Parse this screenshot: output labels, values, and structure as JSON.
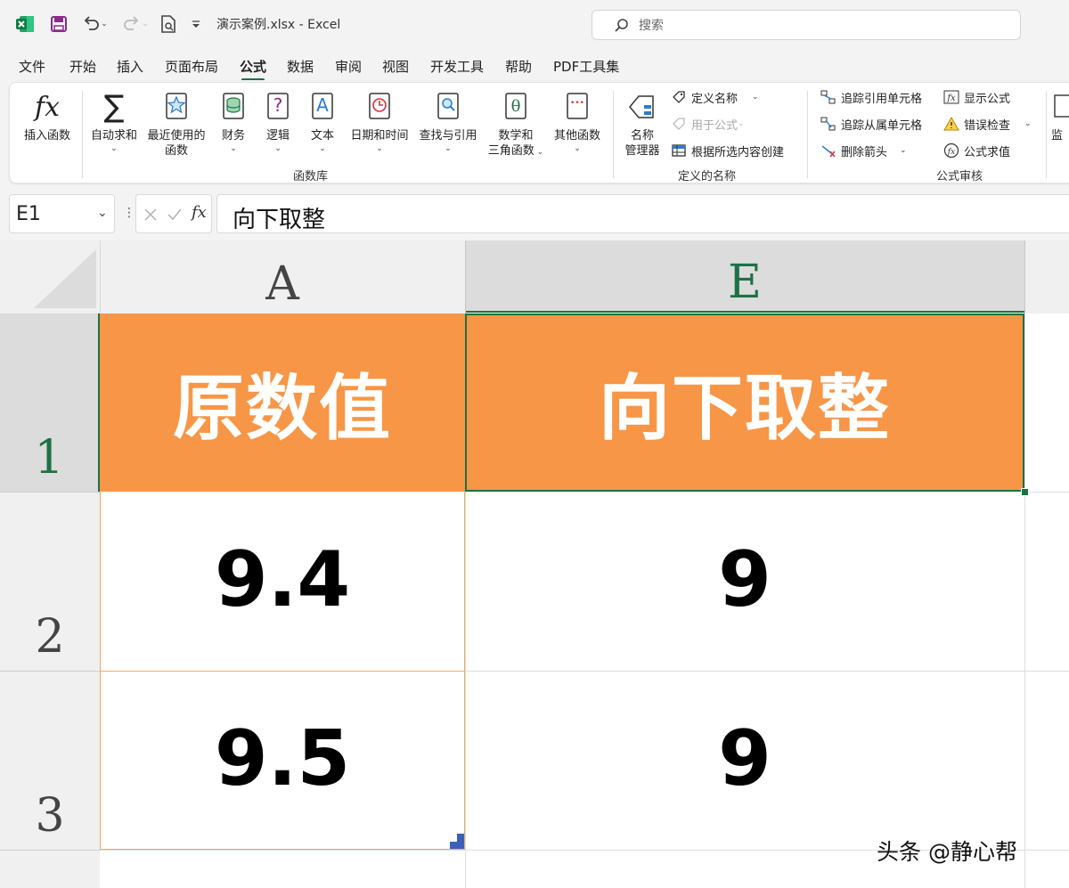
{
  "titlebar": {
    "file_title": "演示案例.xlsx  -  Excel",
    "search_placeholder": "搜索"
  },
  "menu": {
    "tabs": [
      "文件",
      "开始",
      "插入",
      "页面布局",
      "公式",
      "数据",
      "审阅",
      "视图",
      "开发工具",
      "帮助",
      "PDF工具集"
    ],
    "active": "公式"
  },
  "ribbon": {
    "function_library": {
      "label": "函数库",
      "insert_function": "插入函数",
      "autosum": "自动求和",
      "recent_line1": "最近使用的",
      "recent_line2": "函数",
      "financial": "财务",
      "logical": "逻辑",
      "text": "文本",
      "datetime": "日期和时间",
      "lookup": "查找与引用",
      "math_line1": "数学和",
      "math_line2": "三角函数",
      "more": "其他函数"
    },
    "defined_names": {
      "label": "定义的名称",
      "name_manager_line1": "名称",
      "name_manager_line2": "管理器",
      "define_name": "定义名称",
      "use_in_formula": "用于公式",
      "create_from_selection": "根据所选内容创建"
    },
    "formula_auditing": {
      "label": "公式审核",
      "trace_precedents": "追踪引用单元格",
      "trace_dependents": "追踪从属单元格",
      "remove_arrows": "删除箭头",
      "show_formulas": "显示公式",
      "error_checking": "错误检查",
      "evaluate_formula": "公式求值",
      "watch_window_partial": "监"
    },
    "icon_text": {
      "fx": "fx",
      "sigma": "∑",
      "star": "☆",
      "question": "?",
      "text_a": "A",
      "theta": "θ",
      "dots": "•••"
    }
  },
  "formula_bar": {
    "name_box": "E1",
    "fx_label": "fx",
    "content": "向下取整"
  },
  "sheet": {
    "columns": [
      "A",
      "E"
    ],
    "rows": [
      "1",
      "2",
      "3"
    ],
    "cells": {
      "A1": "原数值",
      "E1": "向下取整",
      "A2": "9.4",
      "E2": "9",
      "A3": "9.5",
      "E3": "9"
    },
    "header_fill": "#f79646",
    "accent_green": "#1e7145"
  },
  "watermark": "头条 @静心帮"
}
